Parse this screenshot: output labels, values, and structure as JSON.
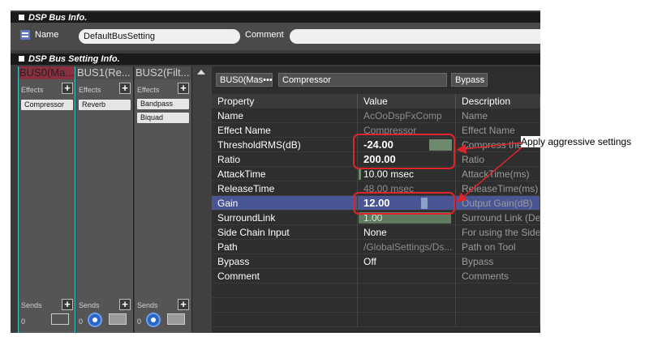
{
  "bus_info": {
    "header": "DSP Bus Info.",
    "name_label": "Name",
    "name_value": "DefaultBusSetting",
    "comment_label": "Comment",
    "comment_value": ""
  },
  "bus_setting": {
    "header": "DSP Bus Setting Info."
  },
  "buses": [
    {
      "title": "BUS0(Ma...",
      "effects_label": "Effects",
      "effects": [
        "Compressor"
      ],
      "sends_label": "Sends",
      "sends_value": "0"
    },
    {
      "title": "BUS1(Re...",
      "effects_label": "Effects",
      "effects": [
        "Reverb"
      ],
      "sends_label": "Sends",
      "sends_value": "0"
    },
    {
      "title": "BUS2(Filt...",
      "effects_label": "Effects",
      "effects": [
        "Bandpass",
        "Biquad"
      ],
      "sends_label": "Sends",
      "sends_value": "0"
    }
  ],
  "editor": {
    "bus_field": "BUS0(Mas•••",
    "effect_field": "Compressor",
    "bypass_field": "Bypass",
    "columns": [
      "Property",
      "Value",
      "Description"
    ],
    "rows": [
      {
        "property": "Name",
        "value": "AcOoDspFxComp",
        "description": "Name"
      },
      {
        "property": "Effect Name",
        "value": "Compressor",
        "description": "Effect Name"
      },
      {
        "property": "ThresholdRMS(dB)",
        "value": "-24.00",
        "description": "Compress the"
      },
      {
        "property": "Ratio",
        "value": "200.00",
        "description": "Ratio"
      },
      {
        "property": "AttackTime",
        "value": "10.00 msec",
        "description": "AttackTime(ms)"
      },
      {
        "property": "ReleaseTime",
        "value": "48.00 msec",
        "description": "ReleaseTime(ms)"
      },
      {
        "property": "Gain",
        "value": "12.00",
        "description": "Output Gain(dB)"
      },
      {
        "property": "SurroundLink",
        "value": "1.00",
        "description": "Surround Link (De"
      },
      {
        "property": "Side Chain Input",
        "value": "None",
        "description": "For using the Side"
      },
      {
        "property": "Path",
        "value": "/GlobalSettings/Ds...",
        "description": "Path on Tool"
      },
      {
        "property": "Bypass",
        "value": "Off",
        "description": "Bypass"
      },
      {
        "property": "Comment",
        "value": "",
        "description": "Comments"
      }
    ]
  },
  "annotation": {
    "text": "Apply aggressive settings"
  },
  "colors": {
    "highlight_row": "#4a5694",
    "annotation_red": "#e0242b",
    "bus0_title_bg": "#8a3040",
    "bus0_border": "#3fc6c6"
  }
}
